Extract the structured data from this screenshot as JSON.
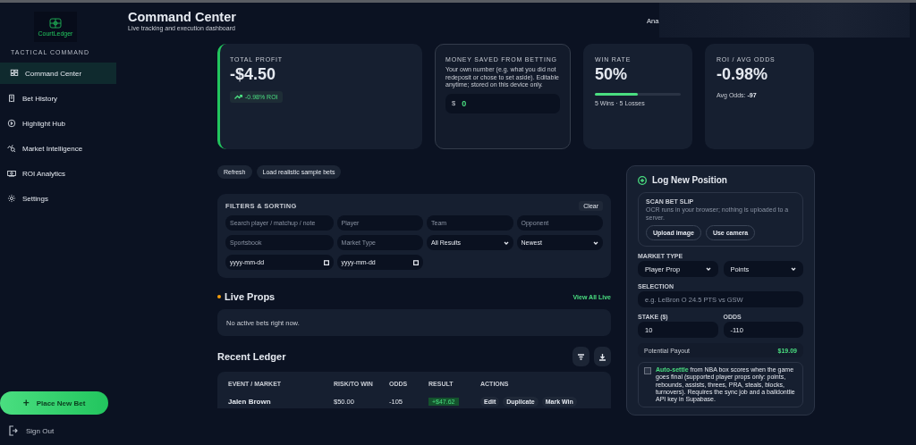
{
  "brand": {
    "logo_text": "CourtLedger",
    "tagline": "TACTICAL COMMAND"
  },
  "nav": [
    {
      "label": "Command Center",
      "selected": true
    },
    {
      "label": "Bet History",
      "selected": false
    },
    {
      "label": "Highlight Hub",
      "selected": false
    },
    {
      "label": "Market Intelligence",
      "selected": false
    },
    {
      "label": "ROI Analytics",
      "selected": false
    },
    {
      "label": "Settings",
      "selected": false
    }
  ],
  "place_button": {
    "icon": "+",
    "label": "Place New Bet"
  },
  "sign_out": {
    "label": "Sign Out"
  },
  "header": {
    "title": "Command Center",
    "subtitle": "Live tracking and execution dashboard",
    "nav_text": "Ana"
  },
  "stats": {
    "total_profit": {
      "label": "TOTAL PROFIT",
      "value": "-$4.50",
      "badge": "-0.98% ROI"
    },
    "money_saved": {
      "label": "MONEY SAVED FROM BETTING",
      "description": "Your own number (e.g. what you did not redeposit or chose to set aside). Editable anytime; stored on this device only.",
      "currency": "$",
      "value": "0"
    },
    "win_rate": {
      "label": "WIN RATE",
      "value": "50%",
      "level": 0.5,
      "record": "5 Wins · 5 Losses"
    },
    "roi": {
      "label": "ROI / AVG ODDS",
      "value": "-0.98%",
      "avg_odds": "Avg Odds: **-97**"
    }
  },
  "actions": [
    "Refresh",
    "Load realistic sample bets"
  ],
  "filters": {
    "title": "FILTERS & SORTING",
    "clear": "Clear",
    "fields": [
      {
        "kind": "text",
        "placeholder": "Search player / matchup / note"
      },
      {
        "kind": "text",
        "placeholder": "Player"
      },
      {
        "kind": "text",
        "placeholder": "Team"
      },
      {
        "kind": "text",
        "placeholder": "Opponent"
      },
      {
        "kind": "text",
        "placeholder": "Sportsbook"
      },
      {
        "kind": "text",
        "placeholder": "Market Type"
      },
      {
        "kind": "select",
        "value": "All Results"
      },
      {
        "kind": "select",
        "value": "Newest"
      },
      {
        "kind": "date",
        "placeholder": "yyyy-mm-dd"
      },
      {
        "kind": "date",
        "placeholder": "yyyy-mm-dd"
      }
    ]
  },
  "live_props": {
    "title": "Live Props",
    "link": "View All Live",
    "empty": "No active bets right now."
  },
  "ledger": {
    "title": "Recent Ledger",
    "columns": [
      "EVENT / MARKET",
      "RISK/TO WIN",
      "ODDS",
      "RESULT",
      "ACTIONS"
    ],
    "rows": [
      {
        "event": "Jalen Brown",
        "risk": "$50.00",
        "odds": "-105",
        "result": "+$47.62",
        "actions": [
          "Edit",
          "Duplicate",
          "Mark Win"
        ]
      }
    ]
  },
  "log_panel": {
    "title": "Log New Position",
    "scan": {
      "title": "SCAN BET SLIP",
      "note": "OCR runs in your browser; nothing is uploaded to a server.",
      "buttons": [
        "Upload image",
        "Use camera"
      ]
    },
    "market_type": {
      "label": "MARKET TYPE",
      "selects": [
        "Player Prop",
        "Points"
      ]
    },
    "selection": {
      "label": "SELECTION",
      "placeholder": "e.g. LeBron O 24.5 PTS vs GSW"
    },
    "stake": {
      "label": "STAKE ($)",
      "value": "10"
    },
    "odds": {
      "label": "ODDS",
      "value": "-110"
    },
    "payout": {
      "label": "Potential Payout",
      "value": "$19.09"
    },
    "auto_settle": {
      "checked": false,
      "highlight": "Auto-settle",
      "text": " from NBA box scores when the game goes final (supported player props only: points, rebounds, assists, threes, PRA, steals, blocks, turnovers). Requires the sync job and a balldontlie API key in Supabase."
    }
  }
}
